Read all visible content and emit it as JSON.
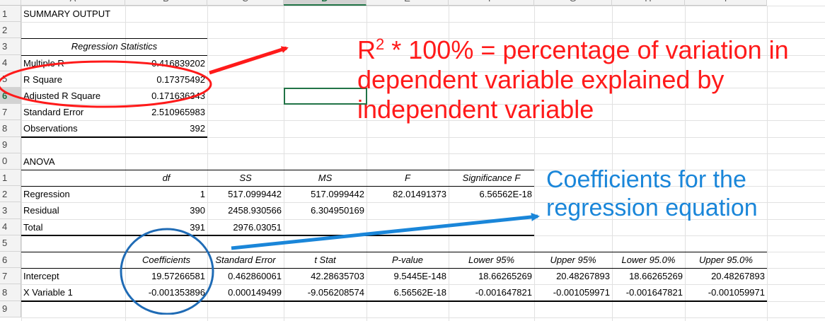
{
  "columns": [
    "A",
    "B",
    "C",
    "D",
    "E",
    "F",
    "G",
    "H",
    "I"
  ],
  "selected_column": "D",
  "rows": [
    "1",
    "2",
    "3",
    "4",
    "5",
    "6",
    "7",
    "8",
    "9",
    "0",
    "1",
    "2",
    "3",
    "4",
    "5",
    "6",
    "7",
    "8",
    "9"
  ],
  "selected_row_index": 5,
  "cells": {
    "summary_output": "SUMMARY OUTPUT",
    "regression_statistics": "Regression Statistics",
    "stats": [
      {
        "label": "Multiple R",
        "value": "0.416839202"
      },
      {
        "label": "R Square",
        "value": "0.17375492"
      },
      {
        "label": "Adjusted R Square",
        "value": "0.171636343"
      },
      {
        "label": "Standard Error",
        "value": "2.510965983"
      },
      {
        "label": "Observations",
        "value": "392"
      }
    ],
    "anova": "ANOVA",
    "anova_headers": [
      "",
      "df",
      "SS",
      "MS",
      "F",
      "Significance F"
    ],
    "anova_rows": [
      [
        "Regression",
        "1",
        "517.0999442",
        "517.0999442",
        "82.01491373",
        "6.56562E-18"
      ],
      [
        "Residual",
        "390",
        "2458.930566",
        "6.304950169",
        "",
        ""
      ],
      [
        "Total",
        "391",
        "2976.03051",
        "",
        "",
        ""
      ]
    ],
    "coef_headers": [
      "",
      "Coefficients",
      "Standard Error",
      "t Stat",
      "P-value",
      "Lower 95%",
      "Upper 95%",
      "Lower 95.0%",
      "Upper 95.0%"
    ],
    "coef_rows": [
      [
        "Intercept",
        "19.57266581",
        "0.462860061",
        "42.28635703",
        "9.5445E-148",
        "18.66265269",
        "20.48267893",
        "18.66265269",
        "20.48267893"
      ],
      [
        "X Variable 1",
        "-0.001353896",
        "0.000149499",
        "-9.056208574",
        "6.56562E-18",
        "-0.001647821",
        "-0.001059971",
        "-0.001647821",
        "-0.001059971"
      ]
    ]
  },
  "annotations": {
    "r2_base": "R",
    "r2_sup": "2",
    "r2_line1_rest": " * 100% = percentage of variation in",
    "r2_line2": "dependent variable explained by",
    "r2_line3": "independent variable",
    "coef_line1": "Coefficients for the",
    "coef_line2": "regression equation",
    "red_color": "#ff1a1a",
    "blue_color": "#1a86d9"
  }
}
